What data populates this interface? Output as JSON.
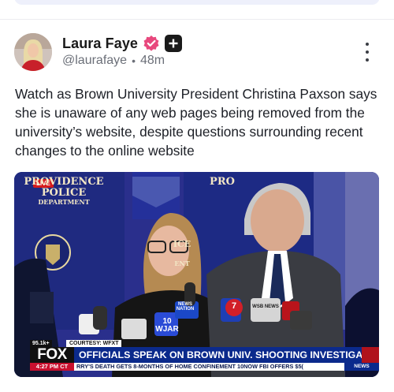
{
  "post": {
    "author_name": "Laura Faye",
    "handle": "@laurafaye",
    "separator": "•",
    "time_ago": "48m",
    "text": "Watch as Brown University President Christina Paxson says she is unaware of any web pages being removed from the university’s website, despite questions surrounding recent changes to the online website"
  },
  "icons": {
    "verified": "verified-badge-icon",
    "plus": "plus-badge-icon",
    "more": "more-options-icon"
  },
  "colors": {
    "verified_pink": "#e8487d",
    "fox_blue": "#0b2a8c",
    "live_red": "#d61c1c"
  },
  "video": {
    "live_label": "LIVE",
    "backdrop_left_line1": "PROVIDENCE",
    "backdrop_left_line2": "POLICE",
    "backdrop_left_line3": "DEPARTMENT",
    "backdrop_right_line1": "PRO",
    "backdrop_mid_fragment": "ICE",
    "backdrop_mid_fragment2": "ENT",
    "temperature": "95.1k+",
    "courtesy": "COURTESY: WFXT",
    "network": "FOX",
    "headline": "OFFICIALS SPEAK ON BROWN UNIV. SHOOTING INVESTIGATION",
    "time": "4:27 PM CT",
    "ticker": "RRY'S DEATH GETS 8-MONTHS OF HOME CONFINEMENT   10NOW   FBI OFFERS $5(",
    "ticker_end": "NEWS",
    "mic_labels": [
      "NEWS NATION",
      "10 WJAR",
      "7",
      "WSB NEWS"
    ]
  }
}
